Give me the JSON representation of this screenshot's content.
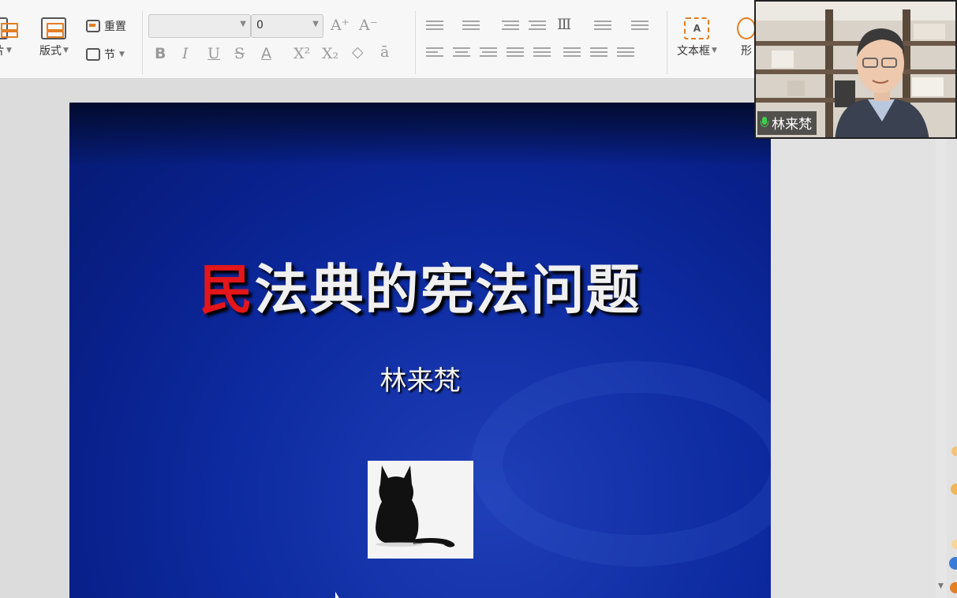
{
  "toolbar": {
    "new_slide_label": "片",
    "layout_label": "版式",
    "reset_label": "重置",
    "section_label": "节",
    "font_name_value": "",
    "font_size_value": "0",
    "text_box_label": "文本框",
    "shape_label": "形"
  },
  "slide": {
    "title_first_char": "民",
    "title_rest": "法典的宪法问题",
    "author": "林来梵"
  },
  "video": {
    "participant_name": "林来梵"
  },
  "colors": {
    "title_accent": "#e3161b",
    "slide_bg": "#0d2a9f",
    "ribbon_accent": "#e67e22",
    "mic_active": "#3cd24a"
  }
}
